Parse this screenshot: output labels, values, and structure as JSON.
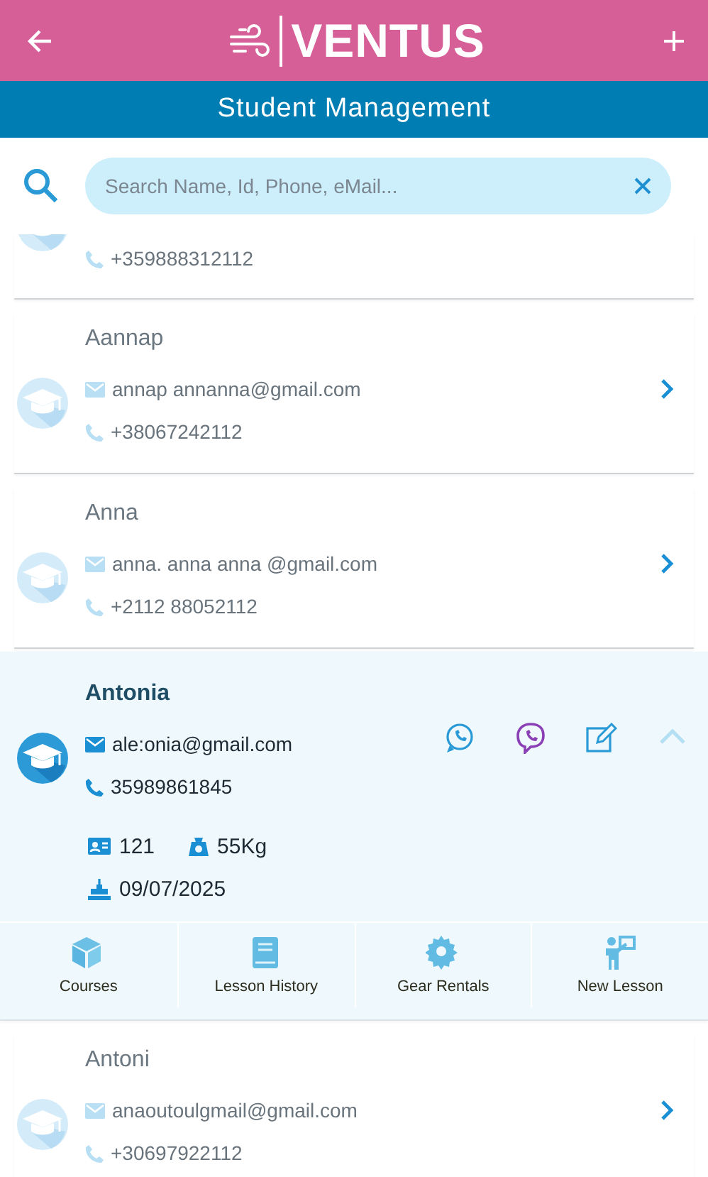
{
  "header": {
    "brand": "VENTUS"
  },
  "title": "Student Management",
  "search": {
    "placeholder": "Search Name, Id, Phone, eMail..."
  },
  "students": [
    {
      "phone": "+359888312112",
      "expanded": false,
      "partial": true
    },
    {
      "name": "Aannap",
      "email": "annap annanna@gmail.com",
      "phone": "+38067242112",
      "expanded": false
    },
    {
      "name": "Anna",
      "email": "anna. anna anna @gmail.com",
      "phone": "+2112 88052112",
      "expanded": false
    },
    {
      "name": "Antonia",
      "email": "ale:onia@gmail.com",
      "phone": "35989861845",
      "expanded": true,
      "student_id": "121",
      "weight": "55Kg",
      "birthday": "09/07/2025",
      "tabs": [
        {
          "kind": "courses",
          "label": "Courses"
        },
        {
          "kind": "history",
          "label": "Lesson History"
        },
        {
          "kind": "gear",
          "label": "Gear Rentals"
        },
        {
          "kind": "lesson",
          "label": "New Lesson"
        }
      ]
    },
    {
      "name": "Antoni",
      "email": "anaoutoulgmail@gmail.com",
      "phone": "+30697922112",
      "expanded": false
    }
  ]
}
